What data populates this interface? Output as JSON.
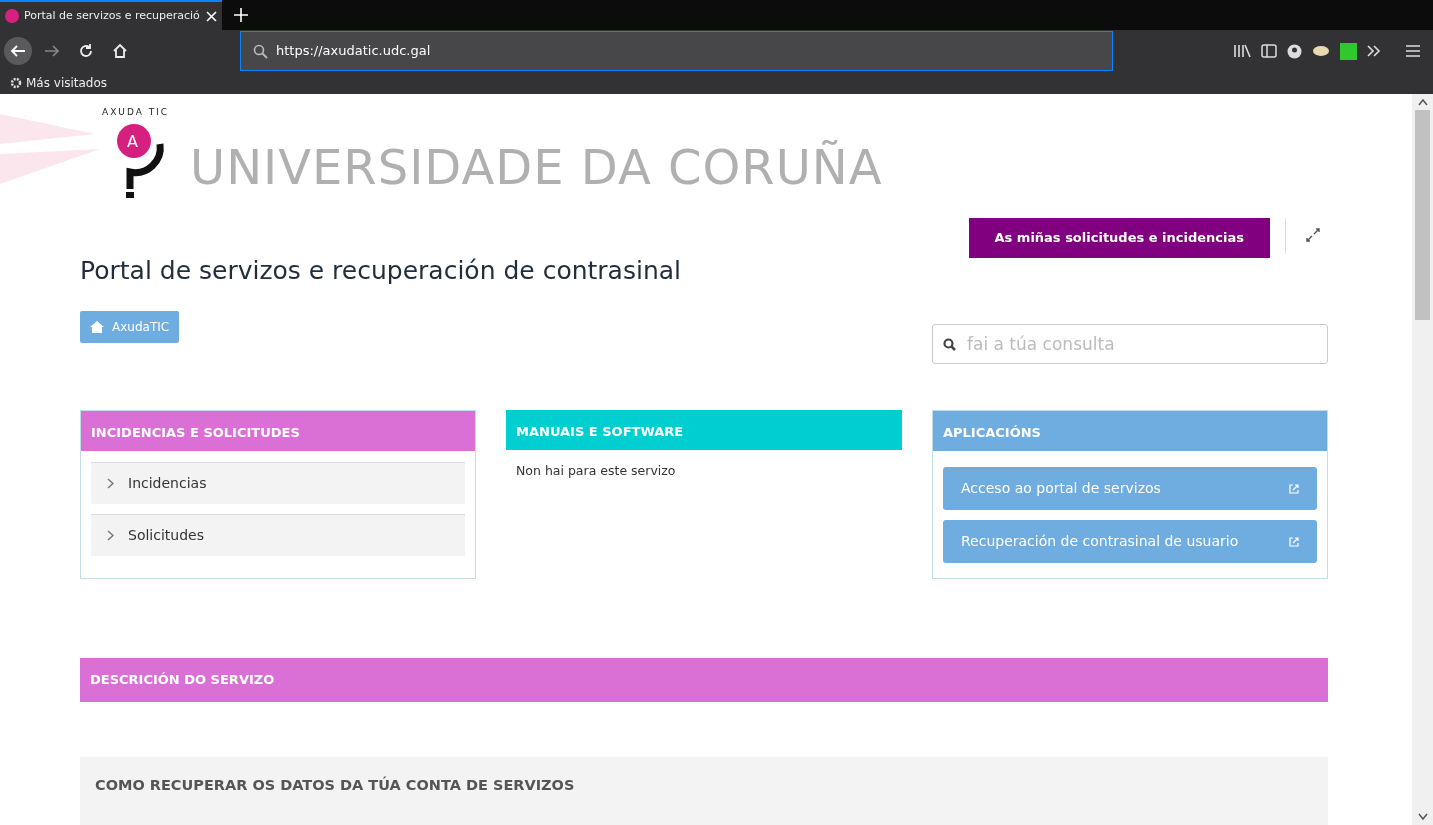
{
  "browser": {
    "tab_title": "Portal de servizos e recuperació",
    "url": "https://axudatic.udc.gal",
    "bookmarks": [
      "Más visitados"
    ]
  },
  "header": {
    "logo_arc": "AXUDA TIC",
    "logo_letter": "A",
    "university": "UNIVERSIDADE DA CORUÑA"
  },
  "my_requests_button": "As miñas solicitudes e incidencias",
  "page_title": "Portal de servizos e recuperación de contrasinal",
  "breadcrumb": "AxudaTIC",
  "search": {
    "placeholder": "fai a túa consulta"
  },
  "panels": [
    {
      "title": "INCIDENCIAS E SOLICITUDES",
      "color": "#da70d6",
      "kind": "accordion",
      "items": [
        "Incidencias",
        "Solicitudes"
      ]
    },
    {
      "title": "MANUAIS E SOFTWARE",
      "color": "#00ced1",
      "kind": "text",
      "items": [
        "Non hai para este servizo"
      ]
    },
    {
      "title": "APLICACIÓNS",
      "color": "#6fade0",
      "kind": "links",
      "items": [
        "Acceso ao portal de servizos",
        "Recuperación de contrasinal de usuario"
      ]
    }
  ],
  "description": {
    "title": "DESCRICIÓN DO SERVIZO",
    "color": "#da70d6"
  },
  "section_title": "COMO RECUPERAR OS DATOS DA TÚA CONTA DE SERVIZOS"
}
